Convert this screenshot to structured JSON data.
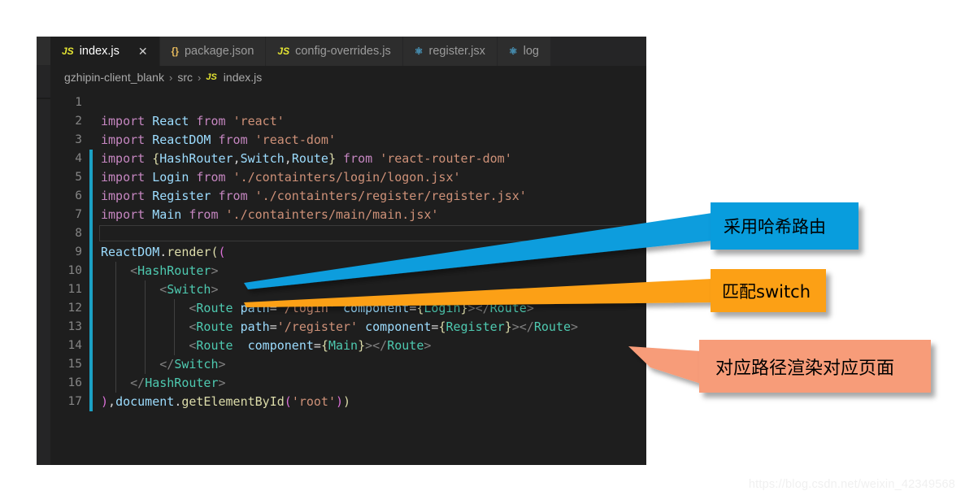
{
  "editor": {
    "tabs": [
      {
        "label": "index.js",
        "icon": "js-file-icon",
        "icon_glyph": "JS",
        "active": true,
        "close_glyph": "✕"
      },
      {
        "label": "package.json",
        "icon": "json-file-icon",
        "icon_glyph": "{}",
        "active": false,
        "close_glyph": ""
      },
      {
        "label": "config-overrides.js",
        "icon": "js-file-icon",
        "icon_glyph": "JS",
        "active": false,
        "close_glyph": ""
      },
      {
        "label": "register.jsx",
        "icon": "react-file-icon",
        "icon_glyph": "⚛",
        "active": false,
        "close_glyph": ""
      },
      {
        "label": "log",
        "icon": "react-file-icon",
        "icon_glyph": "⚛",
        "active": false,
        "close_glyph": ""
      }
    ],
    "breadcrumb": {
      "project": "gzhipin-client_blank",
      "folder": "src",
      "file": "index.js",
      "file_icon_glyph": "JS",
      "separator": "›"
    },
    "lines": [
      {
        "num": "1",
        "changed": false,
        "empty": false,
        "indent_guides": []
      },
      {
        "num": "2",
        "changed": false,
        "empty": false,
        "indent_guides": []
      },
      {
        "num": "3",
        "changed": false,
        "empty": false,
        "indent_guides": []
      },
      {
        "num": "4",
        "changed": true,
        "empty": false,
        "indent_guides": []
      },
      {
        "num": "5",
        "changed": true,
        "empty": false,
        "indent_guides": []
      },
      {
        "num": "6",
        "changed": true,
        "empty": false,
        "indent_guides": []
      },
      {
        "num": "7",
        "changed": true,
        "empty": false,
        "indent_guides": []
      },
      {
        "num": "8",
        "changed": true,
        "empty": true,
        "indent_guides": []
      },
      {
        "num": "9",
        "changed": true,
        "empty": false,
        "indent_guides": []
      },
      {
        "num": "10",
        "changed": true,
        "empty": false,
        "indent_guides": []
      },
      {
        "num": "11",
        "changed": true,
        "empty": false,
        "indent_guides": []
      },
      {
        "num": "12",
        "changed": true,
        "empty": false,
        "indent_guides": []
      },
      {
        "num": "13",
        "changed": true,
        "empty": false,
        "indent_guides": []
      },
      {
        "num": "14",
        "changed": true,
        "empty": false,
        "indent_guides": []
      },
      {
        "num": "15",
        "changed": true,
        "empty": false,
        "indent_guides": []
      },
      {
        "num": "16",
        "changed": true,
        "empty": false,
        "indent_guides": []
      },
      {
        "num": "17",
        "changed": true,
        "empty": false,
        "indent_guides": []
      }
    ],
    "code": {
      "l1": "",
      "l2": "import React from 'react'",
      "l3": "import ReactDOM from 'react-dom'",
      "l4": "import {HashRouter,Switch,Route} from 'react-router-dom'",
      "l5": "import Login from './containters/login/logon.jsx'",
      "l6": "import Register from './containters/register/register.jsx'",
      "l7": "import Main from './containters/main/main.jsx'",
      "l8": "",
      "l9": "ReactDOM.render((",
      "l10": "    <HashRouter>",
      "l11": "        <Switch>",
      "l12": "            <Route path='/login' component={Login}></Route>",
      "l13": "            <Route path='/register' component={Register}></Route>",
      "l14": "            <Route  component={Main}></Route>",
      "l15": "        </Switch>",
      "l16": "    </HashRouter>",
      "l17": "),document.getElementById('root'))"
    }
  },
  "annotations": [
    {
      "text": "采用哈希路由",
      "color": "#089ddd",
      "name": "annotation-hash-router"
    },
    {
      "text": "匹配switch",
      "color": "#fca015",
      "name": "annotation-match-switch"
    },
    {
      "text": "对应路径渲染对应页面",
      "color": "#f79c79",
      "name": "annotation-route-render"
    }
  ],
  "watermark": {
    "text": "https://blog.csdn.net/weixin_42349568"
  }
}
